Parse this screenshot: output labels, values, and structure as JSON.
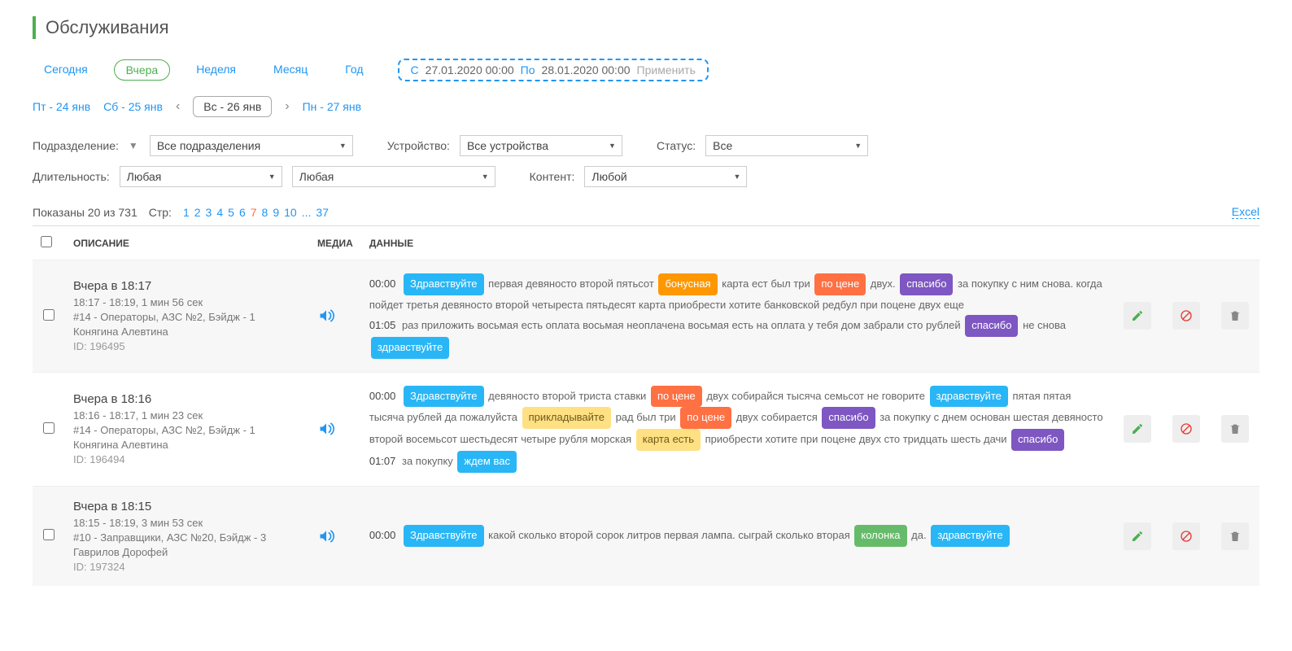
{
  "page_title": "Обслуживания",
  "period_tabs": [
    "Сегодня",
    "Вчера",
    "Неделя",
    "Месяц",
    "Год"
  ],
  "period_active": 1,
  "daterange": {
    "from_label": "С",
    "from_value": "27.01.2020 00:00",
    "to_label": "По",
    "to_value": "28.01.2020 00:00",
    "apply": "Применить"
  },
  "days": {
    "prev2": "Пт - 24 янв",
    "prev1": "Сб - 25 янв",
    "current": "Вс - 26 янв",
    "next1": "Пн - 27 янв"
  },
  "filters": {
    "division_label": "Подразделение:",
    "division_value": "Все подразделения",
    "device_label": "Устройство:",
    "device_value": "Все устройства",
    "status_label": "Статус:",
    "status_value": "Все",
    "duration_label": "Длительность:",
    "duration_from_value": "Любая",
    "duration_to_value": "Любая",
    "content_label": "Контент:",
    "content_value": "Любой"
  },
  "summary": {
    "shown_text": "Показаны 20 из 731",
    "pages_label": "Стр:",
    "pages": [
      "1",
      "2",
      "3",
      "4",
      "5",
      "6",
      "7",
      "8",
      "9",
      "10",
      "...",
      "37"
    ],
    "current_page": "7",
    "export": "Excel"
  },
  "headers": {
    "description": "ОПИСАНИЕ",
    "media": "МЕДИА",
    "data": "ДАННЫЕ"
  },
  "rows": [
    {
      "title": "Вчера в 18:17",
      "time": "18:17 - 18:19, 1 мин 56 сек",
      "location": "#14 - Операторы, АЗС №2, Бэйдж - 1",
      "person": "Конягина Алевтина",
      "id": "ID: 196495",
      "transcript": [
        {
          "ts": "00:00",
          "parts": [
            {
              "t": "tag",
              "c": "blue",
              "v": "Здравствуйте"
            },
            {
              "t": "txt",
              "v": " первая девяносто второй пятьсот "
            },
            {
              "t": "tag",
              "c": "orange",
              "v": "бонусная"
            },
            {
              "t": "txt",
              "v": " карта ест был три "
            },
            {
              "t": "tag",
              "c": "darkorange",
              "v": "по цене"
            },
            {
              "t": "txt",
              "v": " двух. "
            },
            {
              "t": "tag",
              "c": "purple",
              "v": "спасибо"
            },
            {
              "t": "txt",
              "v": " за покупку с ним снова. когда пойдет третья девяносто второй четыреста пятьдесят карта приобрести хотите банковской редбул при поцене двух еще"
            }
          ]
        },
        {
          "ts": "01:05",
          "parts": [
            {
              "t": "txt",
              "v": "раз приложить восьмая есть оплата восьмая неоплачена восьмая есть на оплата у тебя дом забрали сто рублей "
            },
            {
              "t": "tag",
              "c": "purple",
              "v": "спасибо"
            },
            {
              "t": "txt",
              "v": " не снова "
            },
            {
              "t": "tag",
              "c": "blue",
              "v": "здравствуйте"
            }
          ]
        }
      ]
    },
    {
      "title": "Вчера в 18:16",
      "time": "18:16 - 18:17, 1 мин 23 сек",
      "location": "#14 - Операторы, АЗС №2, Бэйдж - 1",
      "person": "Конягина Алевтина",
      "id": "ID: 196494",
      "transcript": [
        {
          "ts": "00:00",
          "parts": [
            {
              "t": "tag",
              "c": "blue",
              "v": "Здравствуйте"
            },
            {
              "t": "txt",
              "v": " девяносто второй триста ставки "
            },
            {
              "t": "tag",
              "c": "darkorange",
              "v": "по цене"
            },
            {
              "t": "txt",
              "v": " двух собирайся тысяча семьсот не говорите "
            },
            {
              "t": "tag",
              "c": "blue",
              "v": "здравствуйте"
            },
            {
              "t": "txt",
              "v": " пятая пятая тысяча рублей да пожалуйста "
            },
            {
              "t": "tag",
              "c": "yellow",
              "v": "прикладывайте"
            },
            {
              "t": "txt",
              "v": " рад был три "
            },
            {
              "t": "tag",
              "c": "darkorange",
              "v": "по цене"
            },
            {
              "t": "txt",
              "v": " двух собирается "
            },
            {
              "t": "tag",
              "c": "purple",
              "v": "спасибо"
            },
            {
              "t": "txt",
              "v": " за покупку с днем основан шестая девяносто второй восемьсот шестьдесят четыре рубля морская "
            },
            {
              "t": "tag",
              "c": "yellow",
              "v": "карта есть"
            },
            {
              "t": "txt",
              "v": " приобрести хотите при поцене двух сто тридцать шесть дачи "
            },
            {
              "t": "tag",
              "c": "purple",
              "v": "спасибо"
            }
          ]
        },
        {
          "ts": "01:07",
          "parts": [
            {
              "t": "txt",
              "v": "за покупку "
            },
            {
              "t": "tag",
              "c": "blue",
              "v": "ждем вас"
            }
          ]
        }
      ]
    },
    {
      "title": "Вчера в 18:15",
      "time": "18:15 - 18:19, 3 мин 53 сек",
      "location": "#10 - Заправщики, АЗС №20, Бэйдж - 3",
      "person": "Гаврилов Дорофей",
      "id": "ID: 197324",
      "transcript": [
        {
          "ts": "00:00",
          "parts": [
            {
              "t": "tag",
              "c": "blue",
              "v": "Здравствуйте"
            },
            {
              "t": "txt",
              "v": " какой сколько второй сорок литров первая лампа. сыграй сколько вторая "
            },
            {
              "t": "tag",
              "c": "green",
              "v": "колонка"
            },
            {
              "t": "txt",
              "v": " да. "
            },
            {
              "t": "tag",
              "c": "blue",
              "v": "здравствуйте"
            }
          ]
        }
      ]
    }
  ]
}
